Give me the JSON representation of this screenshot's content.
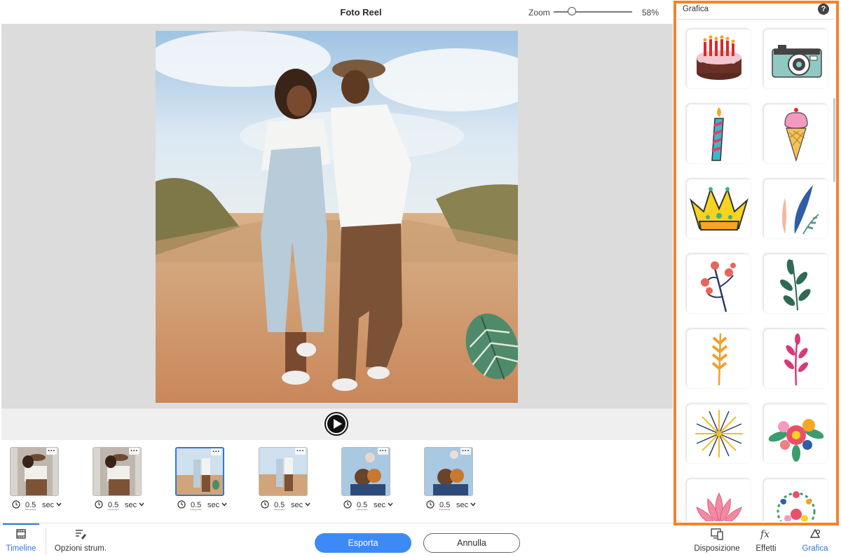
{
  "header": {
    "title": "Foto Reel",
    "zoom_label": "Zoom",
    "zoom_value": "58%",
    "zoom_level": 0.58
  },
  "timeline": {
    "clips": [
      {
        "duration": "0.5",
        "unit": "sec",
        "selected": false
      },
      {
        "duration": "0.5",
        "unit": "sec",
        "selected": false
      },
      {
        "duration": "0.5",
        "unit": "sec",
        "selected": true
      },
      {
        "duration": "0.5",
        "unit": "sec",
        "selected": false
      },
      {
        "duration": "0.5",
        "unit": "sec",
        "selected": false
      },
      {
        "duration": "0.5",
        "unit": "sec",
        "selected": false
      }
    ],
    "more_glyph": "···"
  },
  "bottombar": {
    "timeline_label": "Timeline",
    "opzioni_label": "Opzioni strum.",
    "export_label": "Esporta",
    "cancel_label": "Annulla",
    "disposizione_label": "Disposizione",
    "effetti_label": "Effetti",
    "grafica_label": "Grafica"
  },
  "panel": {
    "title": "Grafica",
    "help": "?",
    "graphics": [
      {
        "icon": "birthday-cake"
      },
      {
        "icon": "camera"
      },
      {
        "icon": "candle"
      },
      {
        "icon": "ice-cream"
      },
      {
        "icon": "crown"
      },
      {
        "icon": "feathers"
      },
      {
        "icon": "berry-branch"
      },
      {
        "icon": "leaf-branch"
      },
      {
        "icon": "orange-sprig"
      },
      {
        "icon": "pink-sprig"
      },
      {
        "icon": "fireworks"
      },
      {
        "icon": "flower-bouquet"
      },
      {
        "icon": "lotus"
      },
      {
        "icon": "flower-wreath"
      }
    ]
  },
  "colors": {
    "accent": "#2d7ad6",
    "export_button": "#3d8af7",
    "panel_highlight": "#f08430"
  }
}
